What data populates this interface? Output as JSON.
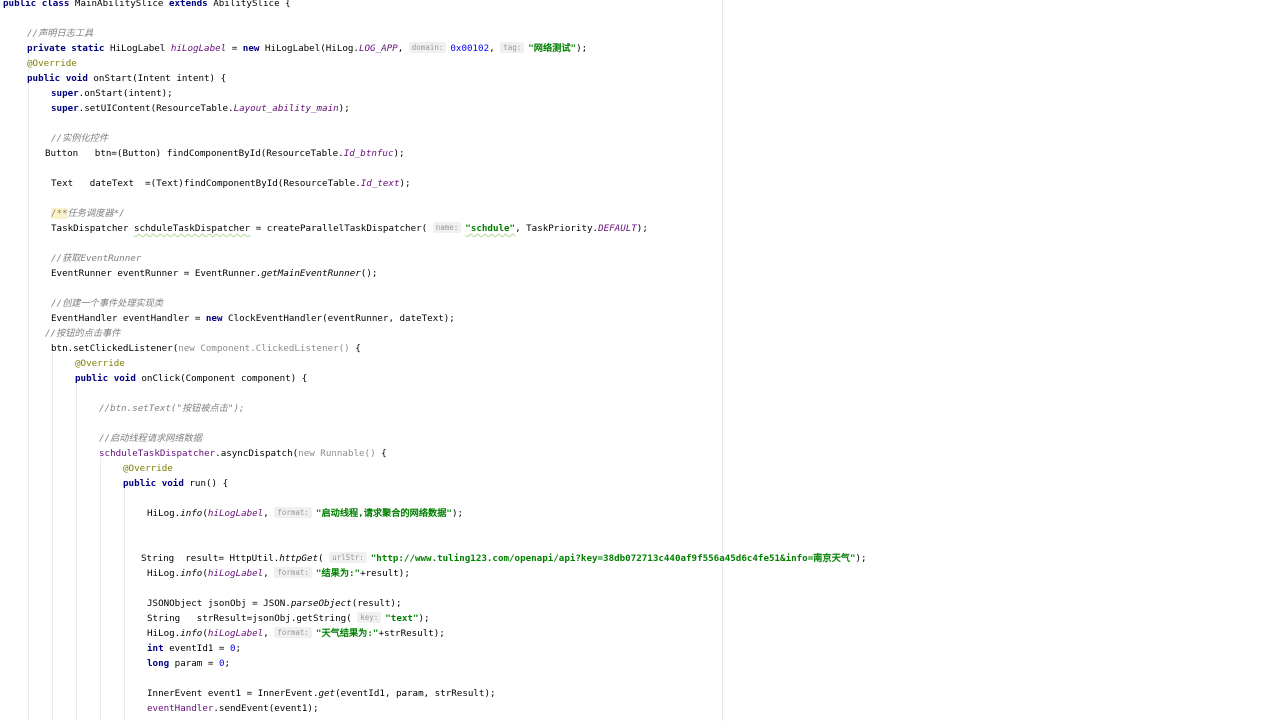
{
  "editor": {
    "language": "java",
    "lines": [
      {
        "indent": 0,
        "parts": [
          {
            "t": "public class",
            "c": "kw"
          },
          {
            "t": " MainAbilitySlice "
          },
          {
            "t": "extends",
            "c": "kw"
          },
          {
            "t": " AbilitySlice {"
          }
        ]
      },
      {
        "indent": 0,
        "parts": []
      },
      {
        "indent": 1,
        "parts": [
          {
            "t": "//声明日志工具",
            "c": "cm"
          }
        ]
      },
      {
        "indent": 1,
        "parts": [
          {
            "t": "private static",
            "c": "kw"
          },
          {
            "t": " HiLogLabel "
          },
          {
            "t": "hiLogLabel",
            "c": "sfield"
          },
          {
            "t": " = "
          },
          {
            "t": "new",
            "c": "kw"
          },
          {
            "t": " HiLogLabel(HiLog."
          },
          {
            "t": "LOG_APP",
            "c": "sfield"
          },
          {
            "t": ", "
          },
          {
            "t": "domain:",
            "c": "hint"
          },
          {
            "t": "0x00102",
            "c": "num"
          },
          {
            "t": ", "
          },
          {
            "t": "tag:",
            "c": "hint"
          },
          {
            "t": "\"网络测试\"",
            "c": "str"
          },
          {
            "t": ");"
          }
        ]
      },
      {
        "indent": 1,
        "parts": [
          {
            "t": "@Override",
            "c": "ann"
          }
        ]
      },
      {
        "indent": 1,
        "parts": [
          {
            "t": "public void",
            "c": "kw"
          },
          {
            "t": " onStart(Intent intent) {"
          }
        ]
      },
      {
        "indent": 2,
        "parts": [
          {
            "t": "super",
            "c": "kw"
          },
          {
            "t": ".onStart(intent);"
          }
        ]
      },
      {
        "indent": 2,
        "parts": [
          {
            "t": "super",
            "c": "kw"
          },
          {
            "t": ".setUIContent(ResourceTable."
          },
          {
            "t": "Layout_ability_main",
            "c": "sfield"
          },
          {
            "t": ");"
          }
        ]
      },
      {
        "indent": 0,
        "parts": []
      },
      {
        "indent": 2,
        "parts": [
          {
            "t": "//实例化控件",
            "c": "cm"
          }
        ]
      },
      {
        "indent": 1.75,
        "parts": [
          {
            "t": "Button   btn=(Button) findComponentById(ResourceTable."
          },
          {
            "t": "Id_btnfuc",
            "c": "sfield"
          },
          {
            "t": ");"
          }
        ]
      },
      {
        "indent": 0,
        "parts": []
      },
      {
        "indent": 2,
        "parts": [
          {
            "t": "Text   dateText  =(Text)findComponentById(ResourceTable."
          },
          {
            "t": "Id_text",
            "c": "sfield"
          },
          {
            "t": ");"
          }
        ]
      },
      {
        "indent": 0,
        "parts": []
      },
      {
        "indent": 2,
        "parts": [
          {
            "t": "/**",
            "c": "cm doc"
          },
          {
            "t": "任务调度器*/",
            "c": "cm"
          }
        ]
      },
      {
        "indent": 2,
        "parts": [
          {
            "t": "TaskDispatcher "
          },
          {
            "t": "schduleTaskDispatcher",
            "c": "wavy"
          },
          {
            "t": " = createParallelTaskDispatcher( "
          },
          {
            "t": "name:",
            "c": "hint"
          },
          {
            "t": "\"schdule\"",
            "c": "str wavy"
          },
          {
            "t": ", TaskPriority."
          },
          {
            "t": "DEFAULT",
            "c": "sfield"
          },
          {
            "t": ");"
          }
        ]
      },
      {
        "indent": 0,
        "parts": []
      },
      {
        "indent": 2,
        "parts": [
          {
            "t": "//获取EventRunner",
            "c": "cm"
          }
        ]
      },
      {
        "indent": 2,
        "parts": [
          {
            "t": "EventRunner eventRunner = EventRunner."
          },
          {
            "t": "getMainEventRunner",
            "c": "smeth"
          },
          {
            "t": "();"
          }
        ]
      },
      {
        "indent": 0,
        "parts": []
      },
      {
        "indent": 2,
        "parts": [
          {
            "t": "//创建一个事件处理实现类",
            "c": "cm"
          }
        ]
      },
      {
        "indent": 2,
        "parts": [
          {
            "t": "EventHandler eventHandler = "
          },
          {
            "t": "new",
            "c": "kw"
          },
          {
            "t": " ClockEventHandler(eventRunner, dateText);"
          }
        ]
      },
      {
        "indent": 1.75,
        "parts": [
          {
            "t": "//按钮的点击事件",
            "c": "cm"
          }
        ]
      },
      {
        "indent": 2,
        "parts": [
          {
            "t": "btn.setClickedListener("
          },
          {
            "t": "new Component.ClickedListener()",
            "c": "gray"
          },
          {
            "t": " {"
          }
        ]
      },
      {
        "indent": 3,
        "parts": [
          {
            "t": "@Override",
            "c": "ann"
          }
        ]
      },
      {
        "indent": 3,
        "parts": [
          {
            "t": "public void",
            "c": "kw"
          },
          {
            "t": " onClick(Component component) {"
          }
        ]
      },
      {
        "indent": 0,
        "parts": []
      },
      {
        "indent": 4,
        "parts": [
          {
            "t": "//btn.setText(\"按钮被点击\");",
            "c": "cm"
          }
        ]
      },
      {
        "indent": 0,
        "parts": []
      },
      {
        "indent": 4,
        "parts": [
          {
            "t": "//启动线程请求网络数据",
            "c": "cm"
          }
        ]
      },
      {
        "indent": 4,
        "parts": [
          {
            "t": "schduleTaskDispatcher",
            "c": "field"
          },
          {
            "t": ".asyncDispatch("
          },
          {
            "t": "new Runnable()",
            "c": "gray"
          },
          {
            "t": " {"
          }
        ]
      },
      {
        "indent": 5,
        "parts": [
          {
            "t": "@Override",
            "c": "ann"
          }
        ]
      },
      {
        "indent": 5,
        "parts": [
          {
            "t": "public void",
            "c": "kw"
          },
          {
            "t": " run() {"
          }
        ]
      },
      {
        "indent": 0,
        "parts": []
      },
      {
        "indent": 6,
        "parts": [
          {
            "t": "HiLog."
          },
          {
            "t": "info",
            "c": "smeth"
          },
          {
            "t": "("
          },
          {
            "t": "hiLogLabel",
            "c": "sfield"
          },
          {
            "t": ", "
          },
          {
            "t": "format:",
            "c": "hint"
          },
          {
            "t": "\"启动线程,请求聚合的网络数据\"",
            "c": "str"
          },
          {
            "t": ");"
          }
        ]
      },
      {
        "indent": 0,
        "parts": []
      },
      {
        "indent": 0,
        "parts": []
      },
      {
        "indent": 5.75,
        "parts": [
          {
            "t": "String  result= HttpUtil."
          },
          {
            "t": "httpGet",
            "c": "smeth"
          },
          {
            "t": "( "
          },
          {
            "t": "urlStr:",
            "c": "hint"
          },
          {
            "t": "\"http://www.tuling123.com/openapi/api?key=38db072713c440af9f556a45d6c4fe51&info=南京天气\"",
            "c": "str"
          },
          {
            "t": ");"
          }
        ]
      },
      {
        "indent": 6,
        "parts": [
          {
            "t": "HiLog."
          },
          {
            "t": "info",
            "c": "smeth"
          },
          {
            "t": "("
          },
          {
            "t": "hiLogLabel",
            "c": "sfield"
          },
          {
            "t": ", "
          },
          {
            "t": "format:",
            "c": "hint"
          },
          {
            "t": "\"结果为:\"",
            "c": "str"
          },
          {
            "t": "+result);"
          }
        ]
      },
      {
        "indent": 0,
        "parts": []
      },
      {
        "indent": 6,
        "parts": [
          {
            "t": "JSONObject jsonObj = JSON."
          },
          {
            "t": "parseObject",
            "c": "smeth"
          },
          {
            "t": "(result);"
          }
        ]
      },
      {
        "indent": 6,
        "parts": [
          {
            "t": "String   strResult=jsonObj.getString( "
          },
          {
            "t": "key:",
            "c": "hint"
          },
          {
            "t": "\"text\"",
            "c": "str"
          },
          {
            "t": ");"
          }
        ]
      },
      {
        "indent": 6,
        "parts": [
          {
            "t": "HiLog."
          },
          {
            "t": "info",
            "c": "smeth"
          },
          {
            "t": "("
          },
          {
            "t": "hiLogLabel",
            "c": "sfield"
          },
          {
            "t": ", "
          },
          {
            "t": "format:",
            "c": "hint"
          },
          {
            "t": "\"天气结果为:\"",
            "c": "str"
          },
          {
            "t": "+strResult);"
          }
        ]
      },
      {
        "indent": 6,
        "parts": [
          {
            "t": "int",
            "c": "kw"
          },
          {
            "t": " eventId1 = "
          },
          {
            "t": "0",
            "c": "num"
          },
          {
            "t": ";"
          }
        ]
      },
      {
        "indent": 6,
        "parts": [
          {
            "t": "long",
            "c": "kw"
          },
          {
            "t": " param = "
          },
          {
            "t": "0",
            "c": "num"
          },
          {
            "t": ";"
          }
        ]
      },
      {
        "indent": 0,
        "parts": []
      },
      {
        "indent": 6,
        "parts": [
          {
            "t": "InnerEvent event1 = InnerEvent."
          },
          {
            "t": "get",
            "c": "smeth"
          },
          {
            "t": "(eventId1, param, strResult);"
          }
        ]
      },
      {
        "indent": 6,
        "parts": [
          {
            "t": "eventHandler",
            "c": "field"
          },
          {
            "t": ".sendEvent(event1);"
          }
        ]
      }
    ]
  }
}
